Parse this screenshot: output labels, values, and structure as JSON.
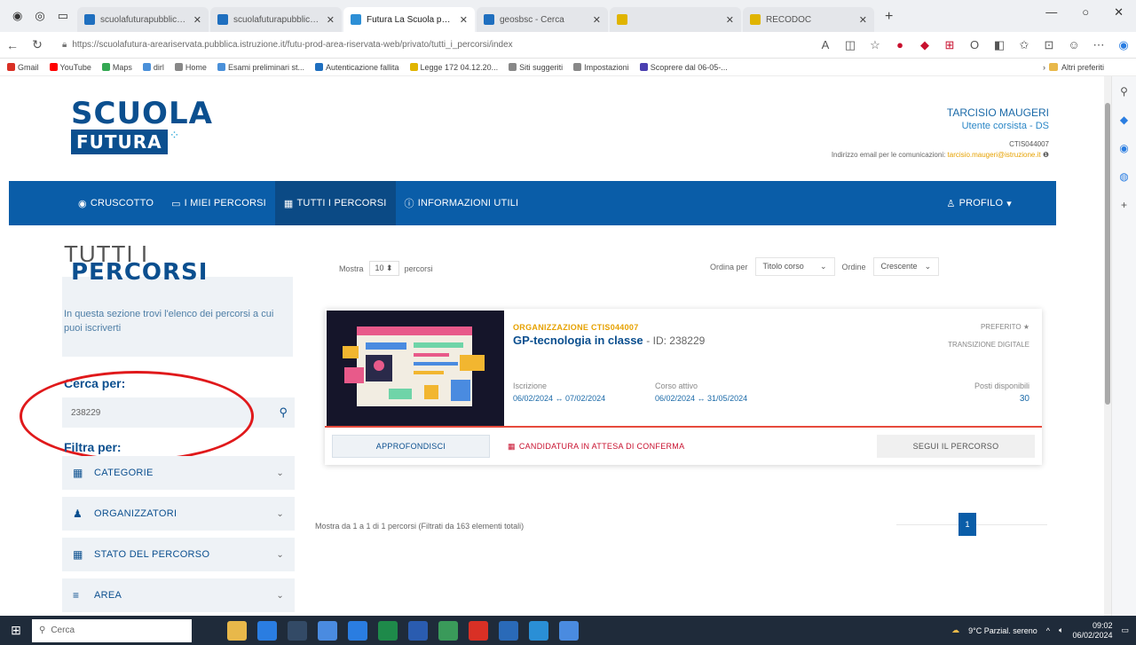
{
  "browser": {
    "tabs": [
      {
        "label": "scuolafuturapubblicaistruzione.it",
        "color": "#1f6fbf"
      },
      {
        "label": "scuolafuturapubblicaistruzione.it",
        "color": "#1f6fbf"
      },
      {
        "label": "Futura La Scuola per l'Italia Di...",
        "color": "#2d8fd6",
        "active": true
      },
      {
        "label": "geosbsc - Cerca",
        "color": "#1f6fbf"
      },
      {
        "label": "",
        "color": "#e0b400"
      },
      {
        "label": "RECODOC",
        "color": "#e0b400"
      }
    ],
    "url": "https://scuolafutura-areariservata.pubblica.istruzione.it/futu-prod-area-riservata-web/privato/tutti_i_percorsi/index",
    "bookmarks": [
      {
        "label": "Gmail",
        "color": "#d93025"
      },
      {
        "label": "YouTube",
        "color": "#ff0000"
      },
      {
        "label": "Maps",
        "color": "#34a853"
      },
      {
        "label": "dirl",
        "color": "#4a90d9"
      },
      {
        "label": "Home",
        "color": "#888888"
      },
      {
        "label": "Esami preliminari st...",
        "color": "#4a90d9"
      },
      {
        "label": "Autenticazione fallita",
        "color": "#1f6fbf"
      },
      {
        "label": "Legge 172 04.12.20...",
        "color": "#e0b400"
      },
      {
        "label": "Siti suggeriti",
        "color": "#888888"
      },
      {
        "label": "Impostazioni",
        "color": "#888888"
      },
      {
        "label": "Scoprere dal 06-05-...",
        "color": "#4a3fb0"
      }
    ],
    "other_favorites": "Altri preferiti"
  },
  "header": {
    "logo_line1": "SCUOLA",
    "logo_line2": "FUTURA",
    "user_name": "TARCISIO MAUGERI",
    "user_role": "Utente corsista - DS",
    "school_code": "CTIS044007",
    "email_label": "Indirizzo email per le comunicazioni:",
    "email_value": "tarcisio.maugeri@istruzione.it"
  },
  "nav": {
    "items": [
      {
        "icon": "◉",
        "label": "CRUSCOTTO"
      },
      {
        "icon": "▭",
        "label": "I MIEI PERCORSI"
      },
      {
        "icon": "▦",
        "label": "TUTTI I PERCORSI",
        "active": true
      },
      {
        "icon": "ⓘ",
        "label": "INFORMAZIONI UTILI"
      }
    ],
    "profile": "PROFILO"
  },
  "sidebar": {
    "title_line1": "TUTTI I",
    "title_line2": "PERCORSI",
    "description": "In questa sezione trovi l'elenco dei percorsi a cui puoi iscriverti",
    "search_label": "Cerca per:",
    "search_value": "238229",
    "filter_label": "Filtra per:",
    "filters": [
      {
        "icon": "▦",
        "label": "CATEGORIE"
      },
      {
        "icon": "♟",
        "label": "ORGANIZZATORI"
      },
      {
        "icon": "▦",
        "label": "STATO DEL PERCORSO"
      },
      {
        "icon": "≡",
        "label": "AREA"
      }
    ]
  },
  "results": {
    "show_prefix": "Mostra",
    "show_count": "10",
    "show_suffix": "percorsi",
    "order_by_label": "Ordina per",
    "order_by_value": "Titolo corso",
    "order_label": "Ordine",
    "order_value": "Crescente",
    "footer": "Mostra da 1 a 1 di 1 percorsi (Filtrati da 163 elementi totali)",
    "page": "1"
  },
  "course": {
    "organization": "ORGANIZZAZIONE CTIS044007",
    "title": "GP-tecnologia in classe",
    "id_text": "- ID: 238229",
    "favorite": "PREFERITO",
    "area": "TRANSIZIONE DIGITALE",
    "iscrizione_label": "Iscrizione",
    "iscrizione_value": "06/02/2024 ↔ 07/02/2024",
    "corso_label": "Corso attivo",
    "corso_value": "06/02/2024 ↔ 31/05/2024",
    "posti_label": "Posti disponibili",
    "posti_value": "30",
    "btn_approfondisci": "APPROFONDISCI",
    "status": "CANDIDATURA IN ATTESA DI CONFERMA",
    "btn_segui": "SEGUI IL PERCORSO"
  },
  "taskbar": {
    "search_placeholder": "Cerca",
    "weather": "9°C Parzial. sereno",
    "time": "09:02",
    "date": "06/02/2024"
  },
  "colors": {
    "brand_blue": "#0b4f8f",
    "nav_blue": "#0a5da8",
    "accent_orange": "#e6a100",
    "status_red": "#c8102e",
    "annotation_red": "#e0191b"
  }
}
